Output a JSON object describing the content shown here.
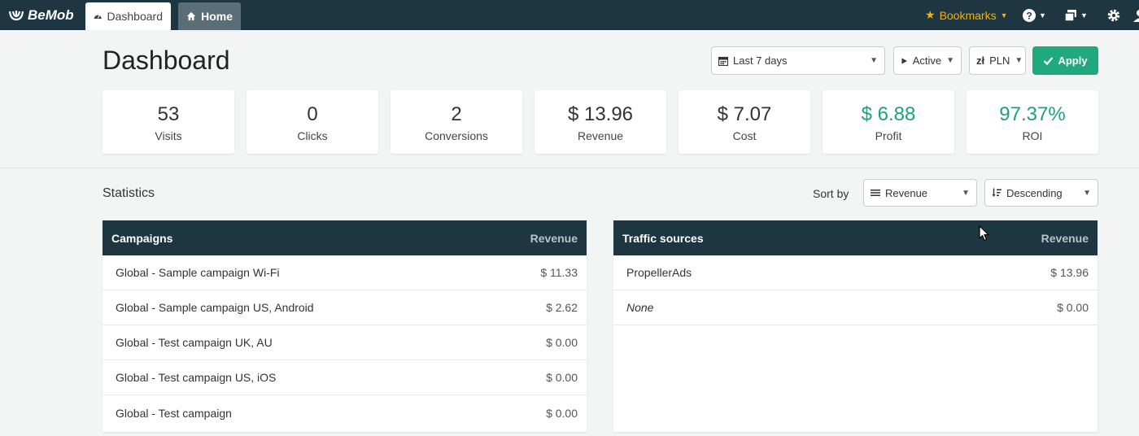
{
  "app": {
    "logo_text": "BeMob"
  },
  "tabs": [
    {
      "label": "Dashboard",
      "active": true
    },
    {
      "label": "Home",
      "active": false
    }
  ],
  "topbar": {
    "bookmarks_label": "Bookmarks",
    "icons": [
      "help-icon",
      "windows-icon",
      "gear-icon",
      "user-icon"
    ]
  },
  "page": {
    "title": "Dashboard",
    "filters": {
      "date_range": "Last 7 days",
      "status": "Active",
      "currency": "PLN",
      "currency_symbol": "zł",
      "apply_label": "Apply"
    }
  },
  "metrics": [
    {
      "value": "53",
      "label": "Visits",
      "highlight": false
    },
    {
      "value": "0",
      "label": "Clicks",
      "highlight": false
    },
    {
      "value": "2",
      "label": "Conversions",
      "highlight": false
    },
    {
      "value": "$ 13.96",
      "label": "Revenue",
      "highlight": false
    },
    {
      "value": "$ 7.07",
      "label": "Cost",
      "highlight": false
    },
    {
      "value": "$ 6.88",
      "label": "Profit",
      "highlight": true
    },
    {
      "value": "97.37%",
      "label": "ROI",
      "highlight": true
    }
  ],
  "statistics": {
    "title": "Statistics",
    "sort_by_label": "Sort by",
    "sort_field": "Revenue",
    "sort_order": "Descending"
  },
  "campaigns_table": {
    "header": {
      "name": "Campaigns",
      "value": "Revenue"
    },
    "rows": [
      {
        "name": "Global - Sample campaign Wi-Fi",
        "value": "$ 11.33"
      },
      {
        "name": "Global - Sample campaign US, Android",
        "value": "$ 2.62"
      },
      {
        "name": "Global - Test campaign UK, AU",
        "value": "$ 0.00"
      },
      {
        "name": "Global - Test campaign US, iOS",
        "value": "$ 0.00"
      },
      {
        "name": "Global - Test campaign",
        "value": "$ 0.00"
      }
    ]
  },
  "traffic_table": {
    "header": {
      "name": "Traffic sources",
      "value": "Revenue"
    },
    "rows": [
      {
        "name": "PropellerAds",
        "value": "$ 13.96"
      },
      {
        "name": "None",
        "value": "$ 0.00"
      }
    ]
  },
  "colors": {
    "nav_bg": "#1e3642",
    "accent_green": "#20a87e",
    "bookmark_yellow": "#f5b100"
  }
}
